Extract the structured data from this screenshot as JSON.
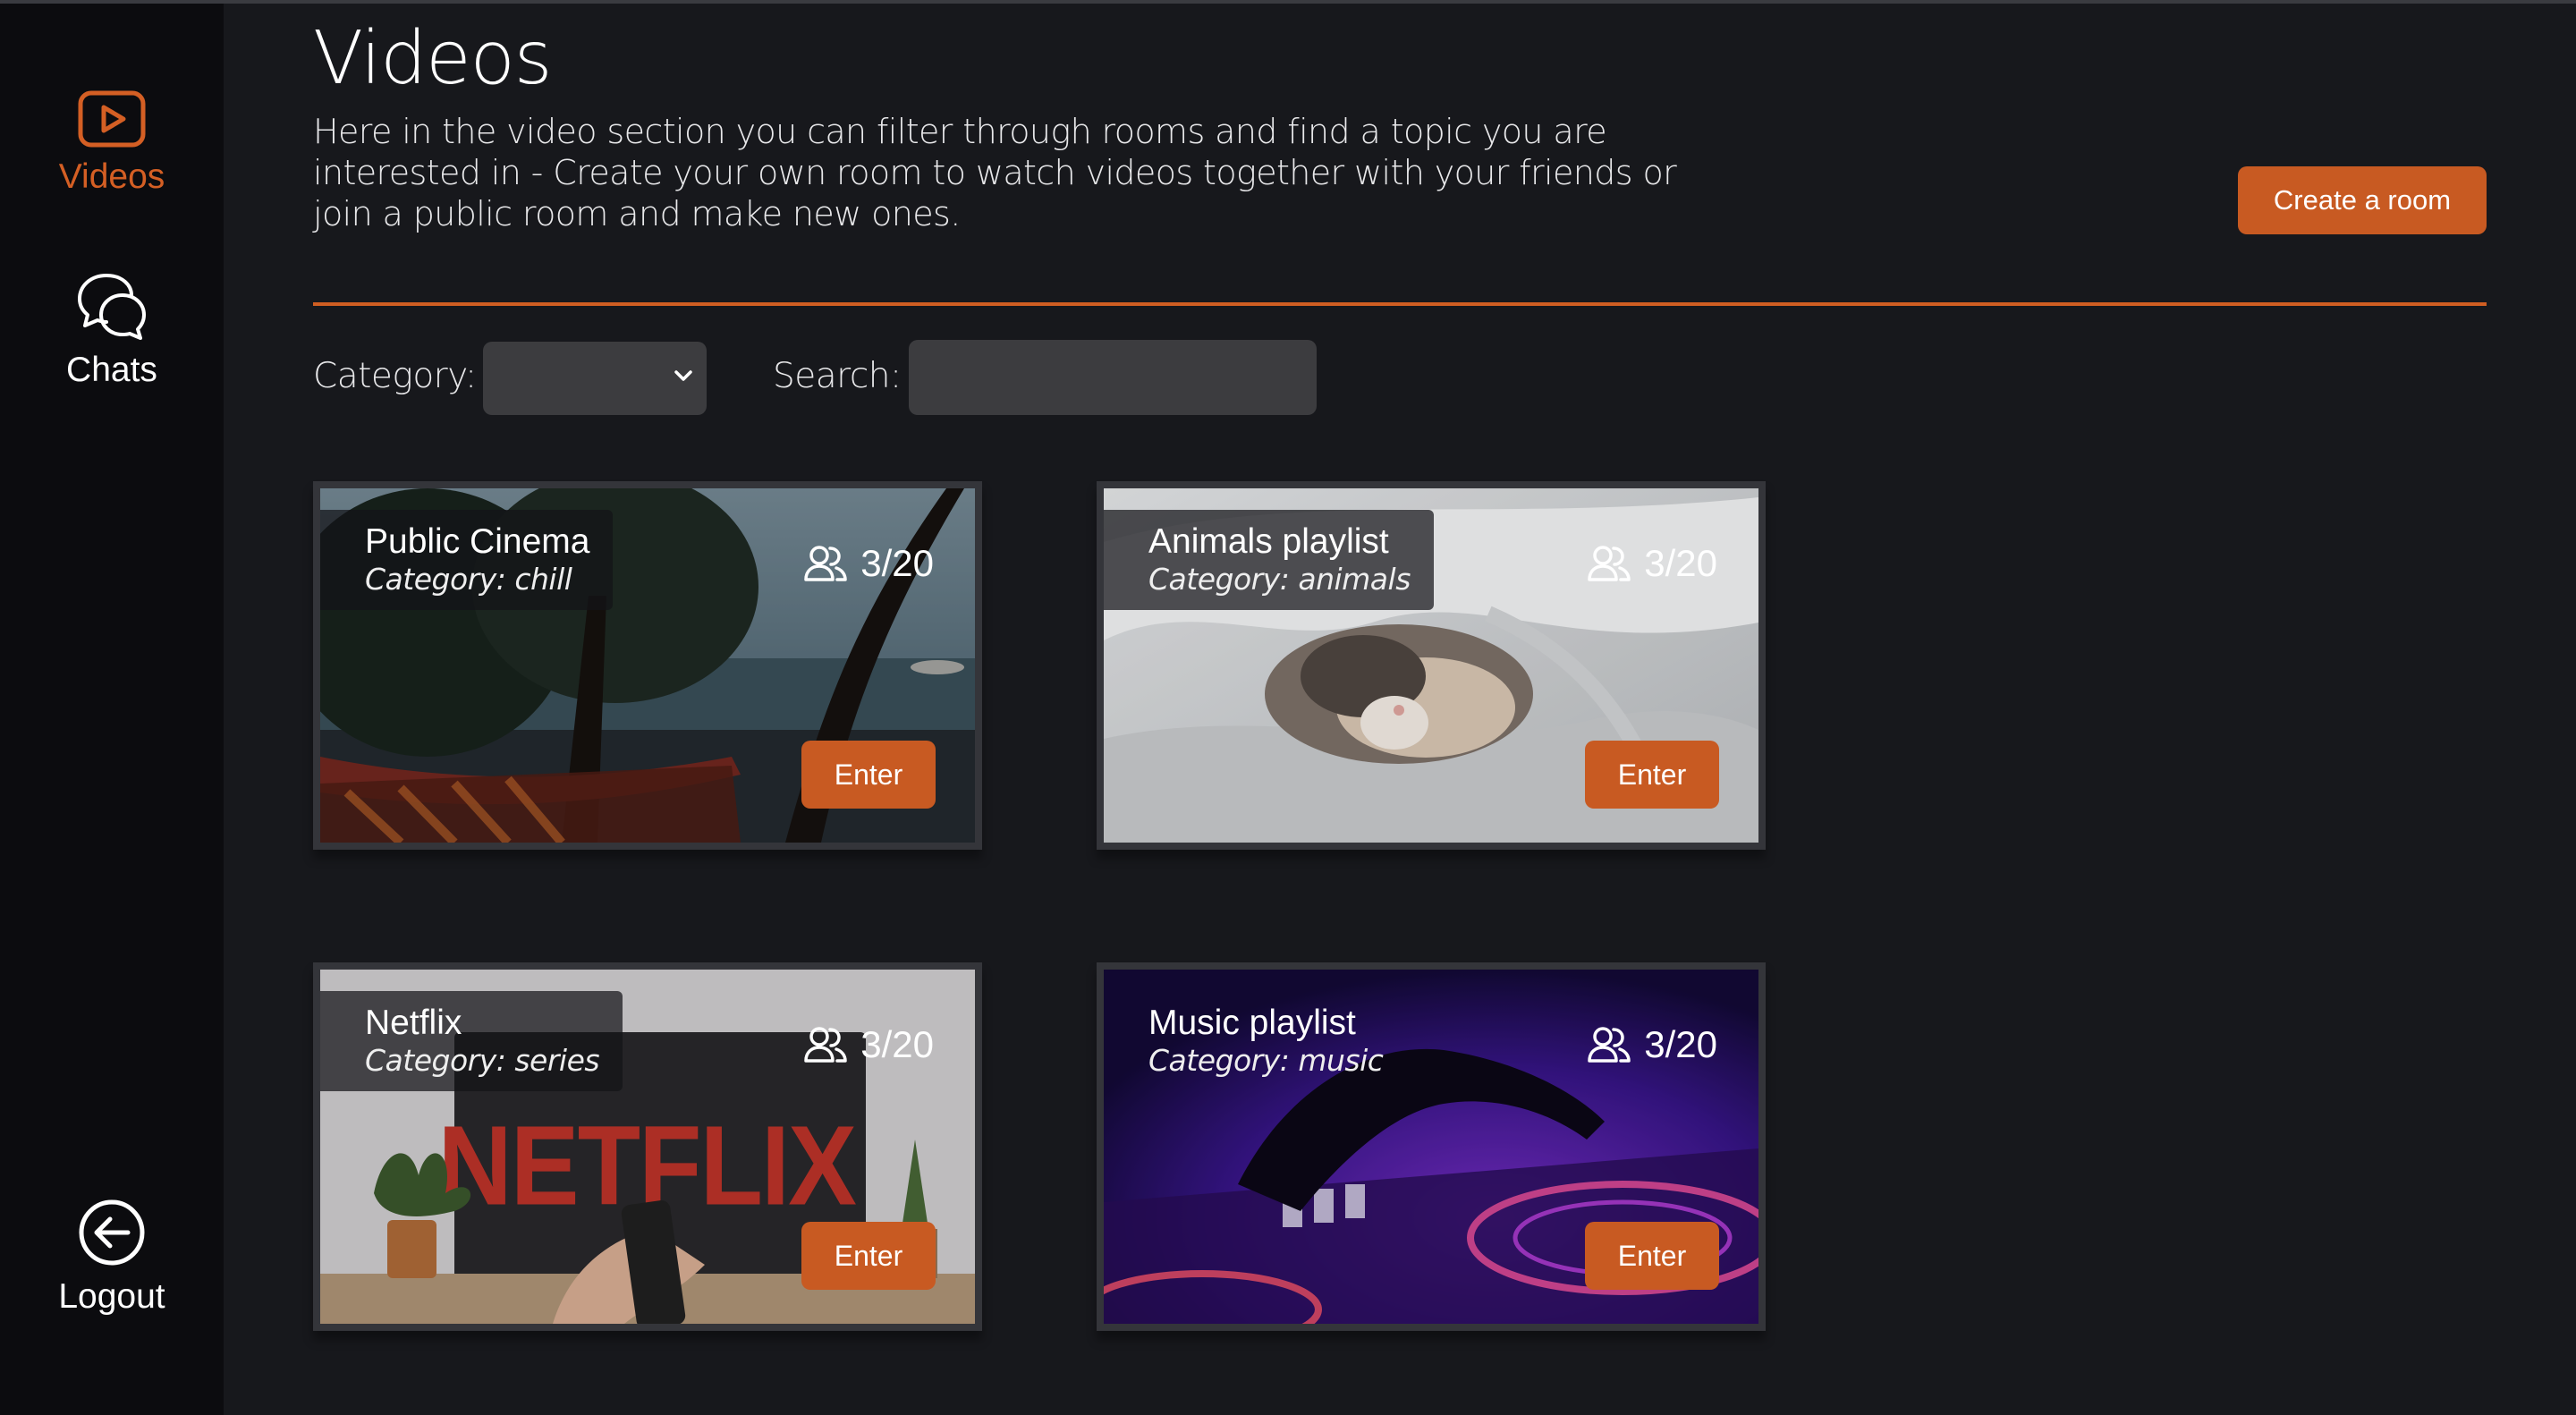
{
  "sidebar": {
    "items": [
      {
        "label": "Videos",
        "icon": "video-play-icon",
        "active": true
      },
      {
        "label": "Chats",
        "icon": "chat-bubbles-icon",
        "active": false
      }
    ],
    "logout": {
      "label": "Logout",
      "icon": "logout-icon"
    }
  },
  "header": {
    "title": "Videos",
    "description": "Here in the video section you can filter through rooms and find a topic you are interested in - Create your own room to watch videos together with your friends or join a public room and make new ones.",
    "create_button": "Create a room"
  },
  "filters": {
    "category_label": "Category:",
    "category_value": "",
    "search_label": "Search:",
    "search_value": ""
  },
  "rooms": [
    {
      "title": "Public Cinema",
      "category": "Category: chill",
      "occupancy": "3/20",
      "action": "Enter",
      "image": "hammock-by-sea"
    },
    {
      "title": "Animals playlist",
      "category": "Category: animals",
      "occupancy": "3/20",
      "action": "Enter",
      "image": "cat-under-blanket"
    },
    {
      "title": "Netflix",
      "category": "Category: series",
      "occupancy": "3/20",
      "action": "Enter",
      "image": "tv-remote-netflix",
      "image_text": "NETFLIX"
    },
    {
      "title": "Music playlist",
      "category": "Category: music",
      "occupancy": "3/20",
      "action": "Enter",
      "image": "dj-turntable"
    }
  ],
  "colors": {
    "background": "#17181c",
    "sidebar": "#0c0c0f",
    "accent": "#c85a22",
    "input": "#3c3c3f"
  }
}
